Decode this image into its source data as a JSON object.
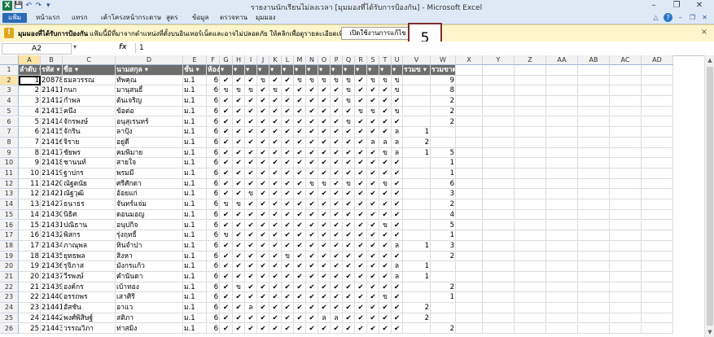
{
  "window": {
    "title": "รายงานนักเรียนไม่ลงเวลา  [มุมมองที่ได้รับการป้องกัน] - Microsoft Excel",
    "logo": "X",
    "qat_icons": [
      "save-icon",
      "undo-icon",
      "redo-icon",
      "customize-icon"
    ],
    "controls": [
      "minimize-icon",
      "restore-icon",
      "close-icon"
    ]
  },
  "ribbon": {
    "tabs": [
      "แฟ้ม",
      "หน้าแรก",
      "แทรก",
      "เค้าโครงหน้ากระดาษ",
      "สูตร",
      "ข้อมูล",
      "ตรวจทาน",
      "มุมมอง"
    ]
  },
  "message_bar": {
    "title": "มุมมองที่ได้รับการป้องกัน",
    "text": "แฟ้มนี้มีที่มาจากตำแหน่งที่ตั้งบนอินเทอร์เน็ตและอาจไม่ปลอดภัย ให้คลิกเพื่อดูรายละเอียดเพิ่มเติม",
    "button": "เปิดใช้งานการแก้ไข",
    "close": "×",
    "color": "#fdf6cc"
  },
  "annotation": {
    "label": "5"
  },
  "formula_bar": {
    "name_box": "A2",
    "fx": "fx",
    "content": "1"
  },
  "sheet": {
    "columns": [
      "A",
      "B",
      "C",
      "D",
      "E",
      "F",
      "G",
      "H",
      "I",
      "J",
      "K",
      "L",
      "M",
      "N",
      "O",
      "P",
      "Q",
      "R",
      "S",
      "T",
      "U",
      "V",
      "W",
      "X",
      "Y",
      "Z",
      "AA",
      "AB",
      "AC",
      "AD"
    ],
    "header_row": [
      "ลำดับ",
      "รหัส",
      "ชื่อ",
      "นามสกุล",
      "ชั้น",
      "ห้อง",
      "",
      "",
      "",
      "",
      "",
      "",
      "",
      "",
      "",
      "",
      "",
      "",
      "",
      "",
      "",
      "รวมข",
      "รวมขาด"
    ],
    "rows": [
      [
        "1",
        "20878",
        "ธมลวรรณ",
        "ทัพคุณ",
        "ม.1",
        "6",
        "✔",
        "✔",
        "✔",
        "ข",
        "✔",
        "✔",
        "ข",
        "ข",
        "ข",
        "ข",
        "ข",
        "✔",
        "ข",
        "ข",
        "ข",
        "",
        "9"
      ],
      [
        "2",
        "21411",
        "กนก",
        "มานุสนธิ์",
        "ม.1",
        "6",
        "ข",
        "ข",
        "ข",
        "✔",
        "ข",
        "✔",
        "✔",
        "✔",
        "✔",
        "✔",
        "ข",
        "✔",
        "✔",
        "✔",
        "ข",
        "",
        "8"
      ],
      [
        "3",
        "21412",
        "กำพล",
        "ต้นเจริญ",
        "ม.1",
        "6",
        "✔",
        "✔",
        "✔",
        "✔",
        "✔",
        "✔",
        "✔",
        "✔",
        "✔",
        "✔",
        "ข",
        "✔",
        "✔",
        "✔",
        "✔",
        "",
        "2"
      ],
      [
        "4",
        "21413",
        "คนึง",
        "ข้อต่อ",
        "ม.1",
        "6",
        "✔",
        "✔",
        "✔",
        "✔",
        "✔",
        "✔",
        "✔",
        "✔",
        "✔",
        "✔",
        "✔",
        "ข",
        "ข",
        "✔",
        "ข",
        "",
        "2"
      ],
      [
        "5",
        "21414",
        "จักรพงษ์",
        "อนุสุเรนทร์",
        "ม.1",
        "6",
        "✔",
        "✔",
        "✔",
        "✔",
        "✔",
        "✔",
        "✔",
        "✔",
        "✔",
        "✔",
        "ข",
        "✔",
        "✔",
        "✔",
        "✔",
        "",
        "2"
      ],
      [
        "6",
        "21415",
        "จักริน",
        "ลาปุ้ง",
        "ม.1",
        "6",
        "✔",
        "✔",
        "✔",
        "✔",
        "✔",
        "✔",
        "✔",
        "✔",
        "✔",
        "✔",
        "✔",
        "✔",
        "✔",
        "✔",
        "ล",
        "1",
        ""
      ],
      [
        "7",
        "21416",
        "จิราย",
        "อยู่ดี",
        "ม.1",
        "6",
        "✔",
        "✔",
        "✔",
        "✔",
        "✔",
        "✔",
        "✔",
        "✔",
        "✔",
        "✔",
        "✔",
        "✔",
        "ล",
        "ล",
        "ล",
        "2",
        ""
      ],
      [
        "8",
        "21417",
        "ชัยพร",
        "คมพิมาย",
        "ม.1",
        "6",
        "✔",
        "✔",
        "✔",
        "✔",
        "✔",
        "✔",
        "✔",
        "✔",
        "✔",
        "✔",
        "✔",
        "✔",
        "✔",
        "ข",
        "ล",
        "1",
        "5"
      ],
      [
        "9",
        "21418",
        "ชานนท์",
        "สายใจ",
        "ม.1",
        "6",
        "✔",
        "✔",
        "✔",
        "✔",
        "✔",
        "✔",
        "✔",
        "✔",
        "✔",
        "✔",
        "✔",
        "✔",
        "✔",
        "✔",
        "✔",
        "",
        "1"
      ],
      [
        "10",
        "21419",
        "ฐาปกร",
        "พรมมี",
        "ม.1",
        "6",
        "✔",
        "✔",
        "✔",
        "✔",
        "✔",
        "✔",
        "✔",
        "✔",
        "✔",
        "✔",
        "✔",
        "✔",
        "✔",
        "✔",
        "✔",
        "",
        "1"
      ],
      [
        "11",
        "21420",
        "ณัฐดนัย",
        "ศรีศักดา",
        "ม.1",
        "6",
        "✔",
        "✔",
        "✔",
        "✔",
        "✔",
        "✔",
        "✔",
        "ข",
        "ข",
        "✔",
        "ข",
        "✔",
        "✔",
        "ข",
        "✔",
        "",
        "6"
      ],
      [
        "12",
        "21421",
        "ณัฐวุฒิ",
        "อ้อยแก่",
        "ม.1",
        "6",
        "✔",
        "✔",
        "ข",
        "✔",
        "✔",
        "✔",
        "✔",
        "✔",
        "✔",
        "✔",
        "✔",
        "✔",
        "✔",
        "✔",
        "✔",
        "",
        "3"
      ],
      [
        "13",
        "21427",
        "ธนาธร",
        "จันทร์แจ่ม",
        "ม.1",
        "6",
        "ข",
        "ข",
        "✔",
        "✔",
        "✔",
        "✔",
        "✔",
        "✔",
        "✔",
        "✔",
        "✔",
        "✔",
        "✔",
        "✔",
        "✔",
        "",
        "2"
      ],
      [
        "14",
        "21430",
        "นิธิศ",
        "ดอนมอญ",
        "ม.1",
        "6",
        "✔",
        "✔",
        "✔",
        "✔",
        "✔",
        "✔",
        "✔",
        "✔",
        "✔",
        "✔",
        "✔",
        "✔",
        "✔",
        "✔",
        "✔",
        "",
        "4"
      ],
      [
        "15",
        "21431",
        "ปณิธาน",
        "อนุปกิจ",
        "ม.1",
        "6",
        "✔",
        "✔",
        "✔",
        "✔",
        "✔",
        "✔",
        "✔",
        "✔",
        "✔",
        "✔",
        "✔",
        "✔",
        "✔",
        "ข",
        "✔",
        "",
        "5"
      ],
      [
        "16",
        "21432",
        "พิสกร",
        "รุ่งฤทธิ์",
        "ม.1",
        "6",
        "ข",
        "✔",
        "✔",
        "✔",
        "✔",
        "✔",
        "✔",
        "✔",
        "✔",
        "✔",
        "✔",
        "✔",
        "✔",
        "✔",
        "✔",
        "",
        "1"
      ],
      [
        "17",
        "21434",
        "ภาณุพล",
        "หินจำปา",
        "ม.1",
        "6",
        "✔",
        "✔",
        "✔",
        "✔",
        "✔",
        "✔",
        "✔",
        "✔",
        "✔",
        "✔",
        "✔",
        "✔",
        "✔",
        "✔",
        "ล",
        "1",
        "3"
      ],
      [
        "18",
        "21435",
        "ยุทธพล",
        "สิงหา",
        "ม.1",
        "6",
        "✔",
        "✔",
        "✔",
        "✔",
        "✔",
        "ข",
        "✔",
        "✔",
        "✔",
        "✔",
        "✔",
        "✔",
        "✔",
        "✔",
        "✔",
        "",
        "2"
      ],
      [
        "19",
        "21436",
        "รุจิภาส",
        "มังกรแก้ว",
        "ม.1",
        "6",
        "✔",
        "✔",
        "✔",
        "✔",
        "✔",
        "✔",
        "✔",
        "✔",
        "✔",
        "✔",
        "✔",
        "✔",
        "✔",
        "✔",
        "ล",
        "1",
        ""
      ],
      [
        "20",
        "21437",
        "วีรพงษ์",
        "คำนันดา",
        "ม.1",
        "6",
        "✔",
        "✔",
        "✔",
        "✔",
        "✔",
        "✔",
        "✔",
        "✔",
        "✔",
        "✔",
        "✔",
        "✔",
        "✔",
        "✔",
        "ล",
        "1",
        ""
      ],
      [
        "21",
        "21439",
        "องค์กร",
        "เบ้าทอง",
        "ม.1",
        "6",
        "✔",
        "ข",
        "✔",
        "✔",
        "✔",
        "✔",
        "✔",
        "✔",
        "✔",
        "✔",
        "✔",
        "✔",
        "✔",
        "✔",
        "✔",
        "",
        "2"
      ],
      [
        "22",
        "21440",
        "อรรถพร",
        "เสาศิริ",
        "ม.1",
        "6",
        "✔",
        "✔",
        "✔",
        "✔",
        "✔",
        "✔",
        "✔",
        "✔",
        "✔",
        "✔",
        "✔",
        "✔",
        "✔",
        "ข",
        "✔",
        "",
        "1"
      ],
      [
        "23",
        "21441",
        "อัสชัน",
        "อาแว",
        "ม.1",
        "6",
        "✔",
        "✔",
        "ล",
        "✔",
        "✔",
        "✔",
        "✔",
        "✔",
        "✔",
        "✔",
        "✔",
        "✔",
        "✔",
        "✔",
        "✔",
        "2",
        ""
      ],
      [
        "24",
        "21442",
        "พงศ์พิสิษฐ์",
        "สติภา",
        "ม.1",
        "6",
        "✔",
        "✔",
        "✔",
        "✔",
        "✔",
        "✔",
        "✔",
        "✔",
        "ล",
        "ล",
        "✔",
        "✔",
        "✔",
        "✔",
        "✔",
        "2",
        ""
      ],
      [
        "25",
        "21443",
        "วรรณวิภา",
        "ท่าสมิง",
        "ม.1",
        "6",
        "✔",
        "✔",
        "✔",
        "✔",
        "✔",
        "✔",
        "✔",
        "✔",
        "✔",
        "✔",
        "✔",
        "✔",
        "✔",
        "✔",
        "✔",
        "",
        "2"
      ]
    ]
  }
}
